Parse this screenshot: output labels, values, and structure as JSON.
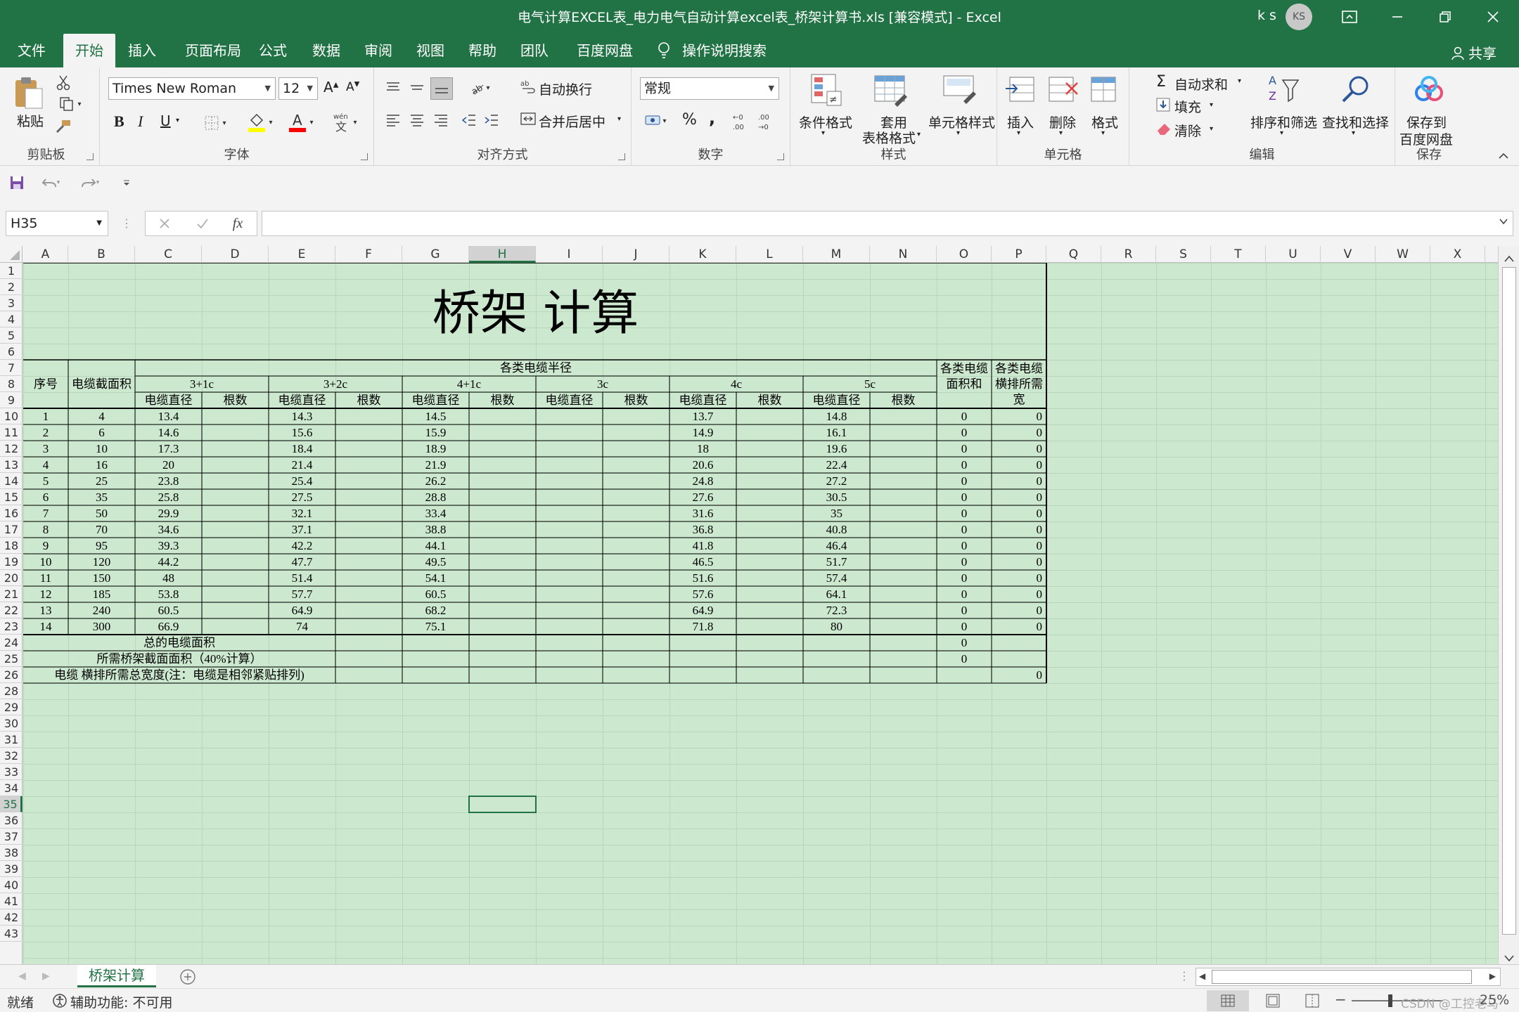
{
  "window": {
    "title": "电气计算EXCEL表_电力电气自动计算excel表_桥架计算书.xls  [兼容模式]  -  Excel",
    "user": "k s",
    "avatar": "KS"
  },
  "tabs": [
    "文件",
    "开始",
    "插入",
    "页面布局",
    "公式",
    "数据",
    "审阅",
    "视图",
    "帮助",
    "团队",
    "百度网盘"
  ],
  "tell_me": "操作说明搜索",
  "share": "共享",
  "ribbon": {
    "clipboard": {
      "paste": "粘贴",
      "label": "剪贴板"
    },
    "font": {
      "name": "Times New Roman",
      "size": "12",
      "label": "字体",
      "bold": "B",
      "italic": "I",
      "underline": "U"
    },
    "alignment": {
      "wrap": "自动换行",
      "merge": "合并后居中",
      "label": "对齐方式"
    },
    "number": {
      "format": "常规",
      "label": "数字",
      "percent": "%",
      "comma": ","
    },
    "styles": {
      "conditional": "条件格式",
      "table1": "套用",
      "table2": "表格格式",
      "cell_styles": "单元格样式",
      "label": "样式"
    },
    "cells": {
      "insert": "插入",
      "delete": "删除",
      "format": "格式",
      "label": "单元格"
    },
    "editing": {
      "autosum": "自动求和",
      "fill": "填充",
      "clear": "清除",
      "sort": "排序和筛选",
      "find": "查找和选择",
      "label": "编辑"
    },
    "save": {
      "line1": "保存到",
      "line2": "百度网盘",
      "label": "保存"
    }
  },
  "formula_bar": {
    "name_box": "H35",
    "fx": "fx",
    "value": ""
  },
  "columns": [
    "A",
    "B",
    "C",
    "D",
    "E",
    "F",
    "G",
    "H",
    "I",
    "J",
    "K",
    "L",
    "M",
    "N",
    "O",
    "P",
    "Q",
    "R",
    "S",
    "T",
    "U",
    "V",
    "W",
    "X"
  ],
  "selected_col": "H",
  "rows": [
    "1",
    "2",
    "3",
    "4",
    "5",
    "6",
    "7",
    "8",
    "9",
    "10",
    "11",
    "12",
    "13",
    "14",
    "15",
    "16",
    "17",
    "18",
    "19",
    "20",
    "21",
    "22",
    "23",
    "24",
    "25",
    "26",
    "28",
    "29",
    "30",
    "31",
    "32",
    "33",
    "34",
    "35",
    "36",
    "37",
    "38",
    "39",
    "40",
    "41",
    "42",
    "43"
  ],
  "selected_row": "35",
  "sheet": {
    "title": "桥架 计算",
    "header_radius": "各类电缆半径",
    "col_seq": "序号",
    "col_section": "电缆截面积",
    "groups": [
      "3+1c",
      "3+2c",
      "4+1c",
      "3c",
      "4c",
      "5c"
    ],
    "sub_dia": "电缆直径",
    "sub_count": "根数",
    "col_area": "各类电缆面积和",
    "col_width": "各类电缆横排所需宽",
    "data_rows": [
      {
        "seq": "1",
        "sec": "4",
        "c": "13.4",
        "e": "14.3",
        "g": "14.5",
        "k": "13.7",
        "m": "14.8",
        "o": "0",
        "p": "0"
      },
      {
        "seq": "2",
        "sec": "6",
        "c": "14.6",
        "e": "15.6",
        "g": "15.9",
        "k": "14.9",
        "m": "16.1",
        "o": "0",
        "p": "0"
      },
      {
        "seq": "3",
        "sec": "10",
        "c": "17.3",
        "e": "18.4",
        "g": "18.9",
        "k": "18",
        "m": "19.6",
        "o": "0",
        "p": "0"
      },
      {
        "seq": "4",
        "sec": "16",
        "c": "20",
        "e": "21.4",
        "g": "21.9",
        "k": "20.6",
        "m": "22.4",
        "o": "0",
        "p": "0"
      },
      {
        "seq": "5",
        "sec": "25",
        "c": "23.8",
        "e": "25.4",
        "g": "26.2",
        "k": "24.8",
        "m": "27.2",
        "o": "0",
        "p": "0"
      },
      {
        "seq": "6",
        "sec": "35",
        "c": "25.8",
        "e": "27.5",
        "g": "28.8",
        "k": "27.6",
        "m": "30.5",
        "o": "0",
        "p": "0"
      },
      {
        "seq": "7",
        "sec": "50",
        "c": "29.9",
        "e": "32.1",
        "g": "33.4",
        "k": "31.6",
        "m": "35",
        "o": "0",
        "p": "0"
      },
      {
        "seq": "8",
        "sec": "70",
        "c": "34.6",
        "e": "37.1",
        "g": "38.8",
        "k": "36.8",
        "m": "40.8",
        "o": "0",
        "p": "0"
      },
      {
        "seq": "9",
        "sec": "95",
        "c": "39.3",
        "e": "42.2",
        "g": "44.1",
        "k": "41.8",
        "m": "46.4",
        "o": "0",
        "p": "0"
      },
      {
        "seq": "10",
        "sec": "120",
        "c": "44.2",
        "e": "47.7",
        "g": "49.5",
        "k": "46.5",
        "m": "51.7",
        "o": "0",
        "p": "0"
      },
      {
        "seq": "11",
        "sec": "150",
        "c": "48",
        "e": "51.4",
        "g": "54.1",
        "k": "51.6",
        "m": "57.4",
        "o": "0",
        "p": "0"
      },
      {
        "seq": "12",
        "sec": "185",
        "c": "53.8",
        "e": "57.7",
        "g": "60.5",
        "k": "57.6",
        "m": "64.1",
        "o": "0",
        "p": "0"
      },
      {
        "seq": "13",
        "sec": "240",
        "c": "60.5",
        "e": "64.9",
        "g": "68.2",
        "k": "64.9",
        "m": "72.3",
        "o": "0",
        "p": "0"
      },
      {
        "seq": "14",
        "sec": "300",
        "c": "66.9",
        "e": "74",
        "g": "75.1",
        "k": "71.8",
        "m": "80",
        "o": "0",
        "p": "0"
      }
    ],
    "total_area_label": "总的电缆面积",
    "total_area_value": "0",
    "tray_area_label": "所需桥架截面面积（40%计算）",
    "tray_area_value": "0",
    "total_width_label": "电缆 横排所需总宽度(注：电缆是相邻紧贴排列)",
    "total_width_value": "0"
  },
  "sheet_tab": "桥架计算",
  "status": {
    "ready": "就绪",
    "accessibility": "辅助功能: 不可用",
    "watermark": "CSDN @工控老马",
    "zoom": "25%"
  },
  "colors": {
    "excel_green": "#217346",
    "grid_bg": "#cce8cf",
    "ribbon_bg": "#f3f3f3"
  }
}
